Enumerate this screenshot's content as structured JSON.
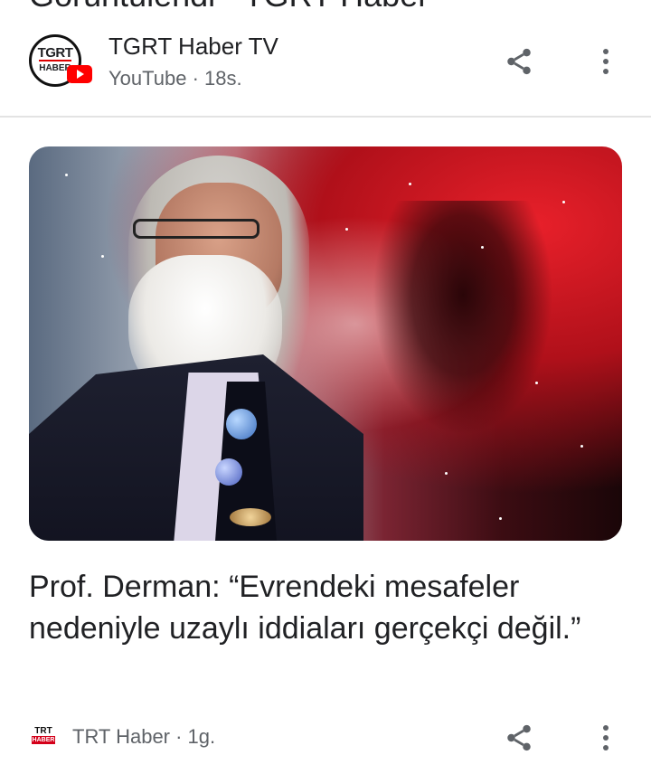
{
  "previous_card": {
    "title_fragment": "Görüntülendi - TGRT Haber"
  },
  "card1_source": {
    "name": "TGRT Haber TV",
    "meta": "YouTube · 18s.",
    "logo_text_1": "TGRT",
    "logo_text_2": "HABER"
  },
  "article": {
    "headline": "Prof. Derman: “Evrendeki mesafeler nedeniyle uzaylı iddiaları gerçekçi değil.”"
  },
  "card2_source": {
    "name": "TRT Haber · 1g.",
    "logo_text_1": "TRT",
    "logo_text_2": "HABER"
  },
  "icons": {
    "share": "share-icon",
    "more": "more-vert-icon",
    "youtube": "youtube-icon"
  },
  "colors": {
    "youtube_red": "#ff0000",
    "text": "#202124",
    "meta": "#5f6368"
  }
}
